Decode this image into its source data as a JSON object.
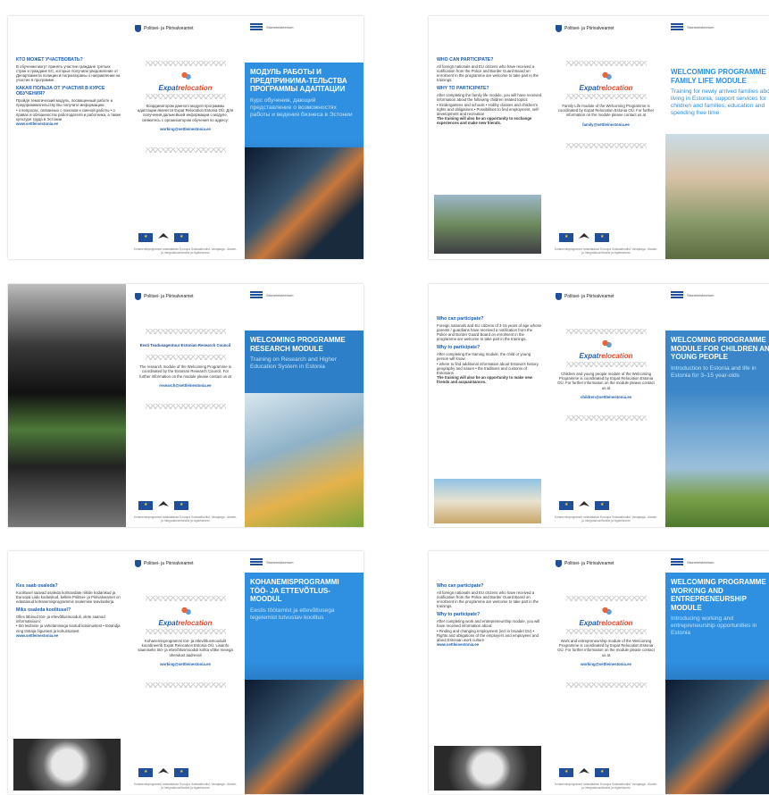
{
  "ministry": "Politsei- ja Piirivalveamet",
  "est_label": "Siseministeerium",
  "org_mark": {
    "main": "Expat",
    "accent": "relocation",
    "sub": "ESTONIA"
  },
  "footer_small": "Kohanemisprogrammi rahastatakse Euroopa Sotsiaalfondist. Vanajaaga - Alande- ja Integratsioonifondist ja riigieelarvest",
  "sheets": [
    {
      "left": {
        "q1": "КТО МОЖЕТ УЧАСТВОВАТЬ?",
        "t1": "В обучении могут принять участие граждане третьих стран и граждане ЕС, которые получили уведомление от Департамента полиции и погранохраны о направлении на участие в программе.",
        "q2": "КАКАЯ ПОЛЬЗА ОТ УЧАСТИЯ В КУРСЕ ОБУЧЕНИЯ?",
        "t2": "Пройдя тематический модуль, посвященный работе и предпринимательству Вы получите информацию:",
        "t3": "• о вопросах, связанных с поиском и сменой работы • о правах и обязанностях работодателя и работника, а также культуре труда в Эстонии",
        "link": "www.settleinestonia.ee"
      },
      "mid": {
        "info": "Координатором данного модуля программы адаптации является Expat Relocation Estonia OÜ. Для получения дальнейшей информации о модуле, свяжитесь с организатором обучения по адресу:",
        "email": "working@settleinestonia.ee"
      },
      "cover": {
        "title": "МОДУЛЬ РАБОТЫ И ПРЕДПРИНИМА-ТЕЛЬСТВА ПРОГРАММЫ АДАПТАЦИИ",
        "subtitle": "Курс обучения, дающий представление о возможностях работы и ведения бизнеса в Эстонии"
      }
    },
    {
      "left": {
        "q1": "WHO CAN PARTICIPATE?",
        "t1": "All foreign nationals and EU citizens who have received a notification from the Police and Border Guard Board on enrolment in the programme are welcome to take part in the trainings.",
        "q2": "WHY TO PARTICIPATE?",
        "t2": "After completing the family life module, you will have received information about the following children related topics:",
        "t3": "• Kindergartens and schools • Hobby classes and children's rights and obligations • Possibilities to find employment, self-development and recreation",
        "link": "The training will also be an opportunity to exchange experiences and make new friends."
      },
      "mid": {
        "info": "Family Life module of the Welcoming Programme is coordinated by Expat Relocation Estonia OÜ. For further information on the module please contact us at",
        "email": "family@settleinestonia.ee"
      },
      "cover": {
        "title": "WELCOMING PROGRAMME FAMILY LIFE MODULE",
        "subtitle": "Training for newly arrived families about living in Estonia, support services for children and families, education and spending free time"
      }
    },
    {
      "left": {
        "q1": "",
        "t1": "",
        "q2": "",
        "t2": "",
        "t3": "",
        "link": ""
      },
      "mid": {
        "org": "Eesti Teadusagentuur Estonian Research Council",
        "info": "The research module of the Welcoming Programme is coordinated by the Estonian Research Council. For further information on the module please contact us at",
        "email": "research@settleinestonia.ee"
      },
      "cover": {
        "title": "WELCOMING PROGRAMME RESEARCH MODULE",
        "subtitle": "Training on Research and Higher Education System in Estonia"
      }
    },
    {
      "left": {
        "q1": "Who can participate?",
        "t1": "Foreign nationals and EU citizens of 3-15 years of age whose parents / guardians have received a notification from the Police and Border Guard Board on enrolment in the programme are welcome to take part in the trainings.",
        "q2": "Why to participate?",
        "t2": "After completing the training module, the child or young person will know:",
        "t3": "• where to find additional information about Estonia's history, geography and nature • the traditions and customs of Estonians",
        "link": "The training will also be an opportunity to make new friends and acquaintances."
      },
      "mid": {
        "info": "Children and young people module of the Welcoming Programme is coordinated by Expat Relocation Estonia OÜ. For further information on the module please contact us at",
        "email": "children@settleinestonia.ee"
      },
      "cover": {
        "title": "WELCOMING PROGRAMME MODULE FOR CHILDREN AND YOUNG PEOPLE",
        "subtitle": "Introduction to Estonia and life in Estonia for 3–15 year-olds"
      }
    },
    {
      "left": {
        "q1": "Kes saab osaleda?",
        "t1": "Koolitusel saavad osaleda kolmandate riikide kodanikud ja Euroopa Liidu kodanikud, kellele Politsei- ja Piirivalveamet on edastanud kohanemisprogrammis osalemise teavituskirja.",
        "q2": "Miks osaleda koolitusel?",
        "t2": "Olles läbinud töö- ja ettevõtlusmooduli, olete saanud informatsiooni:",
        "t3": "• töö leidmise ja vahetamisega seotud küsimustest • tööandja ning töötaja õigustest ja kohustustest",
        "link": "www.settleinestonia.ee"
      },
      "mid": {
        "info": "Kohanemisprogrammi töö- ja ettevõtlusmoodulit koordineerib Expat Relocation Estonia OÜ. Lisainfo saamiseks töö- ja ettevõtlusmooduli kohta võtke meiega ühendust aadressil",
        "email": "working@settleinestonia.ee"
      },
      "cover": {
        "title": "KOHANEMISPROGRAMMI TÖÖ- JA ETTEVÕTLUS-MOODUL",
        "subtitle": "Eestis töötamist ja ettevõtlusega tegelemist tutvustav koolitus"
      }
    },
    {
      "left": {
        "q1": "Who can participate?",
        "t1": "All foreign nationals and EU citizens who have received a notification from the Police and Border Guard Board on enrolment in the programme are welcome to take part in the trainings.",
        "q2": "Why to participate?",
        "t2": "After completing work and entrepreneurship module, you will have received information about:",
        "t3": "• Finding and changing employment (incl in broader EU) • Rights and obligations of the employers and employees and about Estonian work culture",
        "link": "www.settleinestonia.ee"
      },
      "mid": {
        "info": "Work and entrepreneurship module of the Welcoming Programme is coordinated by Expat Relocation Estonia OÜ. For further information on the module please contact us at",
        "email": "working@settleinestonia.ee"
      },
      "cover": {
        "title": "WELCOMING PROGRAMME WORKING AND ENTREPRENEURSHIP MODULE",
        "subtitle": "Introducing working and entrepreneurship opportunities in Estonia"
      }
    }
  ]
}
